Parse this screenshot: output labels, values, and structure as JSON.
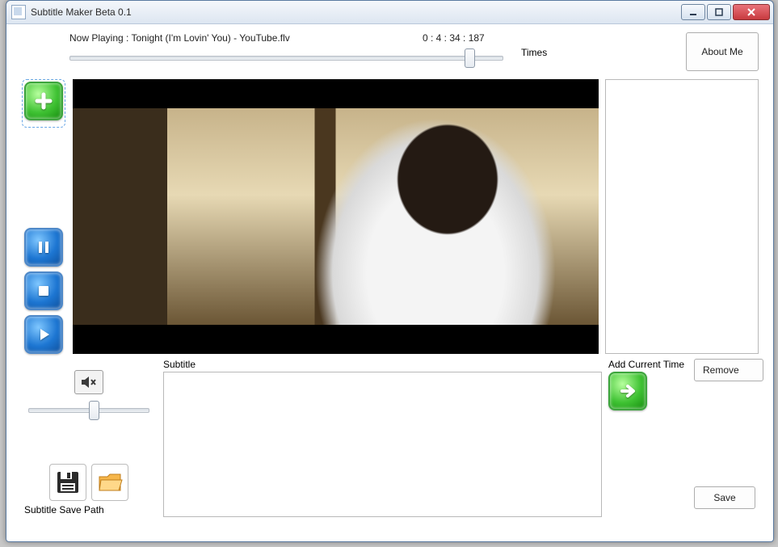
{
  "window": {
    "title": "Subtitle Maker Beta 0.1"
  },
  "header": {
    "now_playing": "Now Playing : Tonight (I'm Lovin' You) - YouTube.flv",
    "timecode": "0 : 4 : 34 : 187",
    "about_label": "About Me"
  },
  "times": {
    "label": "Times",
    "items": []
  },
  "subtitle": {
    "label": "Subtitle",
    "value": ""
  },
  "add_current_time": {
    "label": "Add Current Time"
  },
  "buttons": {
    "remove": "Remove",
    "save": "Save"
  },
  "save_path": {
    "label": "Subtitle Save Path"
  },
  "seek_percent": 91,
  "volume_percent": 50
}
